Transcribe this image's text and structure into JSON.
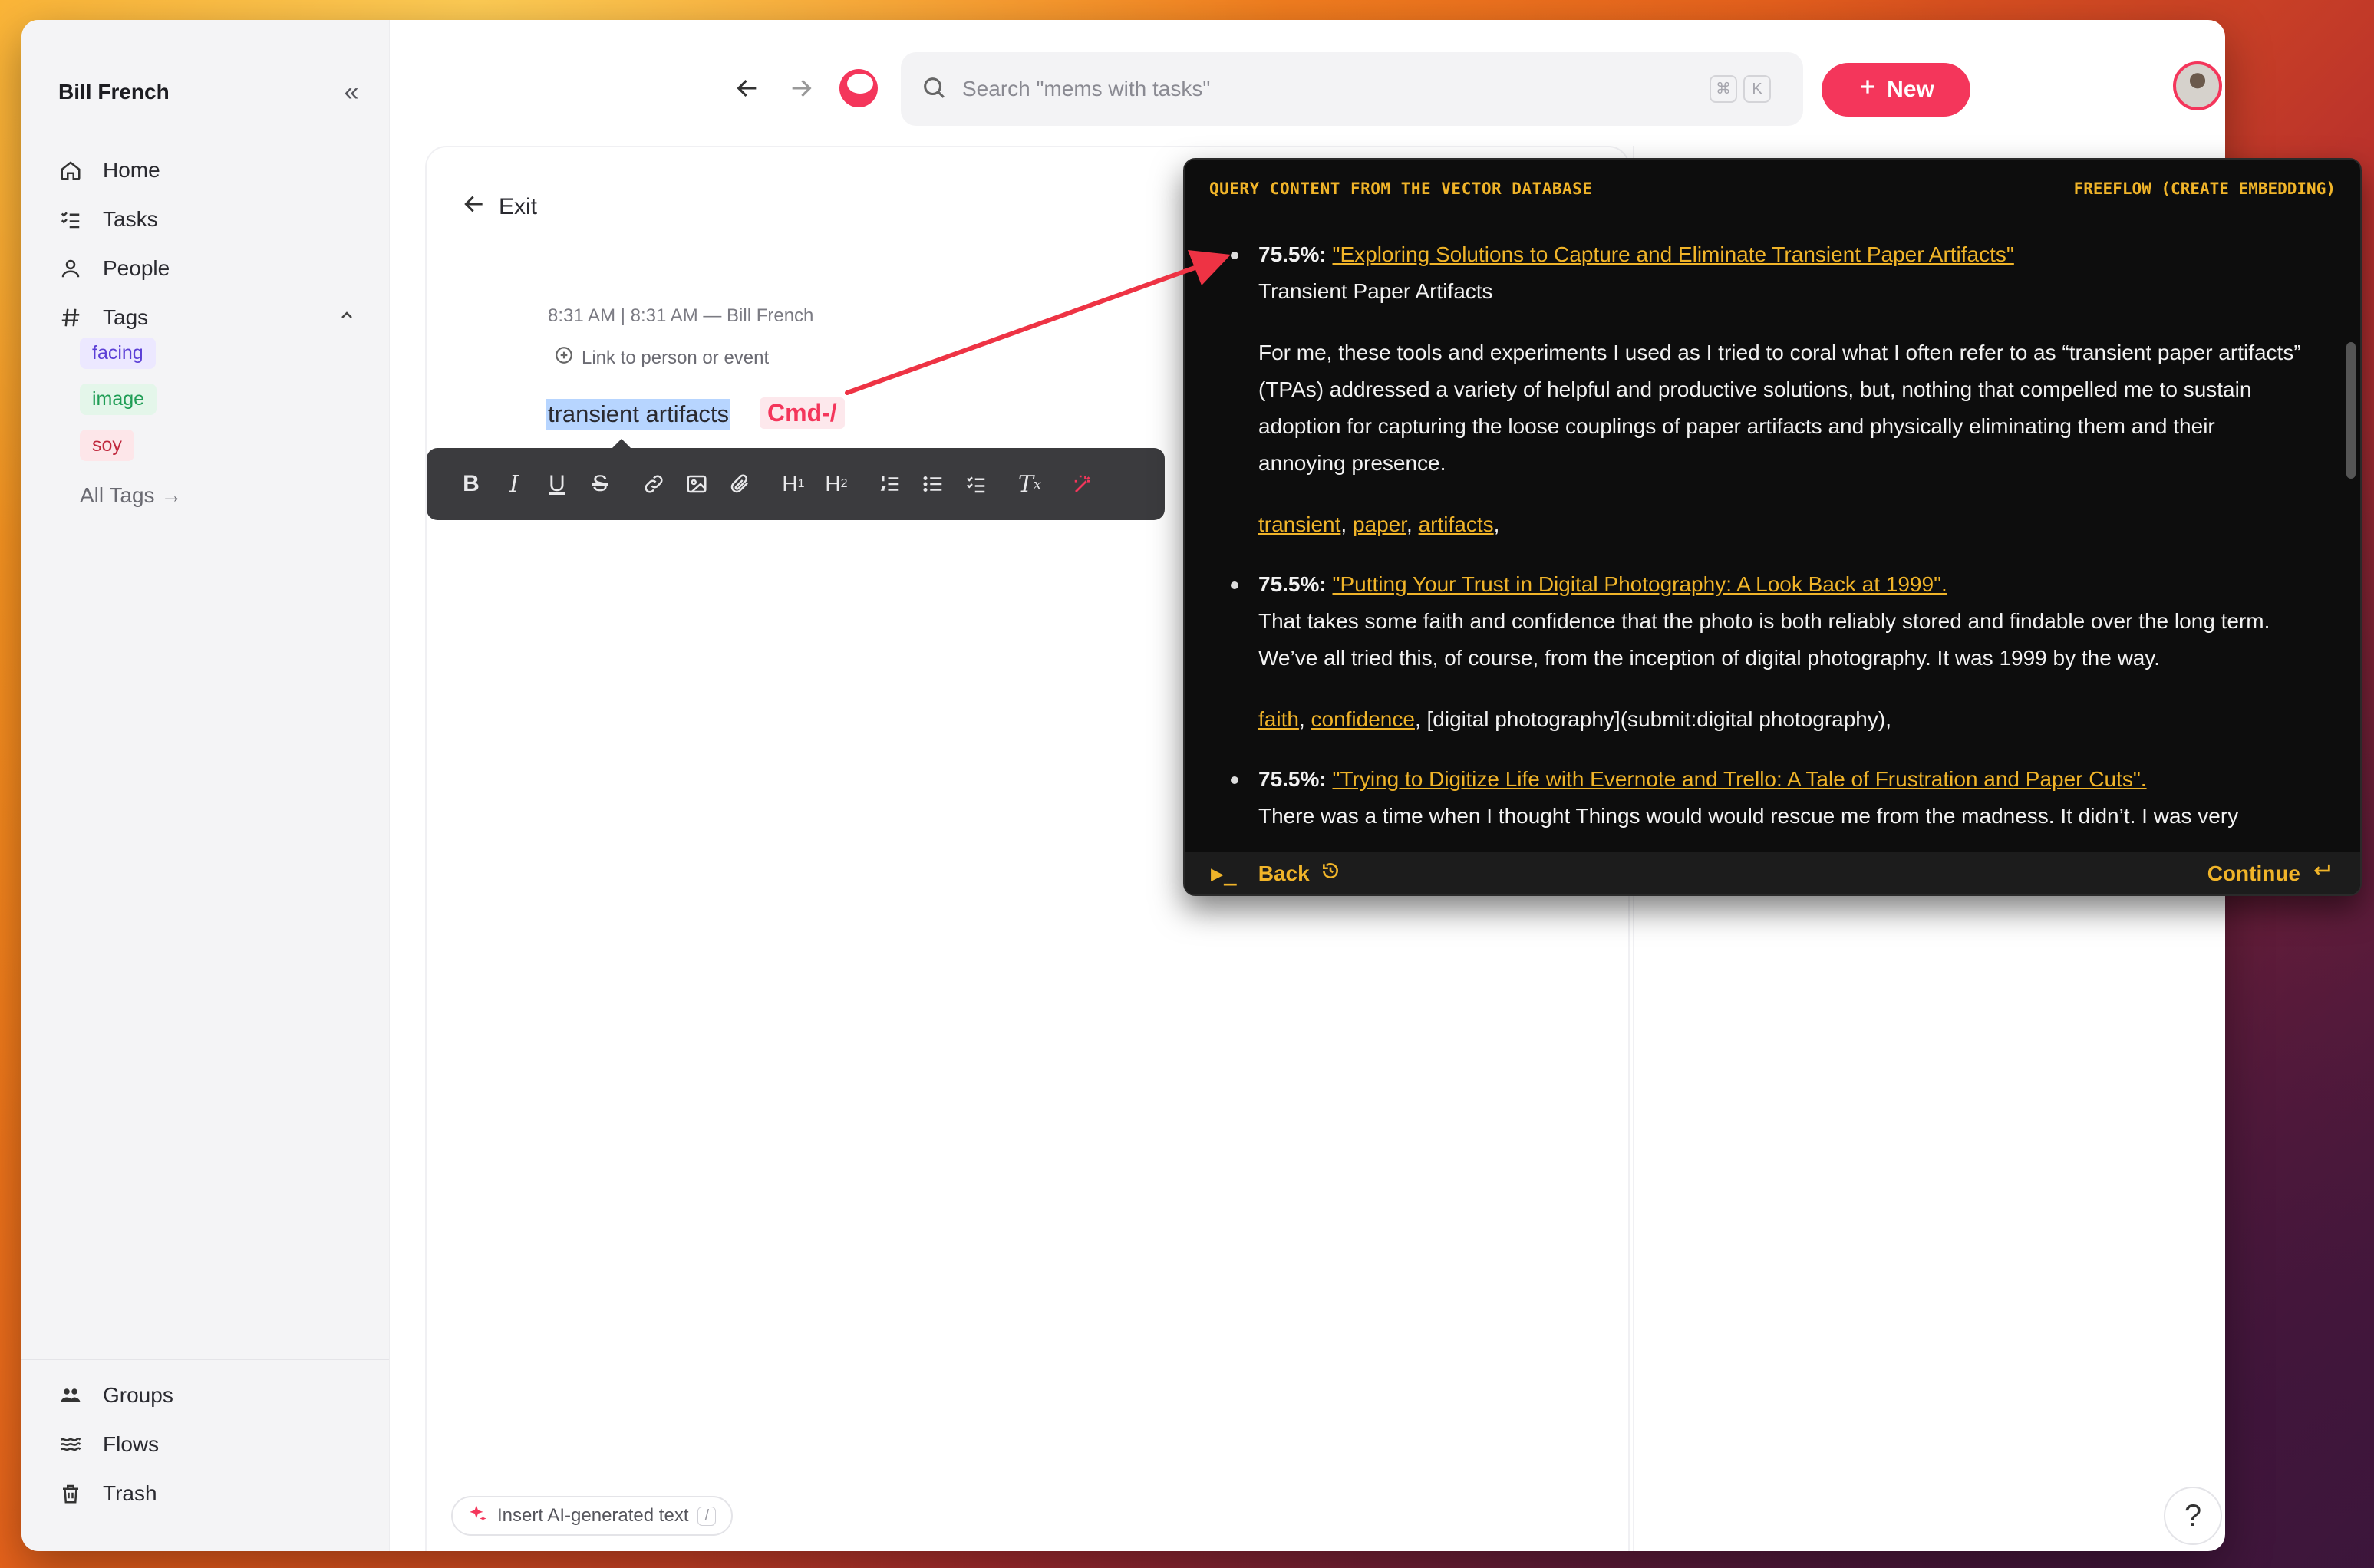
{
  "sidebar": {
    "user_name": "Bill French",
    "nav": [
      {
        "label": "Home",
        "icon": "home-icon"
      },
      {
        "label": "Tasks",
        "icon": "tasks-icon"
      },
      {
        "label": "People",
        "icon": "person-icon"
      },
      {
        "label": "Tags",
        "icon": "hash-icon"
      }
    ],
    "tags": [
      {
        "label": "facing",
        "color": "#5b3fd6",
        "bg": "#ece8ff"
      },
      {
        "label": "image",
        "color": "#1f9d55",
        "bg": "#e4f6ea"
      },
      {
        "label": "soy",
        "color": "#c0283d",
        "bg": "#fde6e9"
      }
    ],
    "all_tags": "All Tags →",
    "bottom": [
      {
        "label": "Groups",
        "icon": "groups-icon"
      },
      {
        "label": "Flows",
        "icon": "flows-icon"
      },
      {
        "label": "Trash",
        "icon": "trash-icon"
      }
    ]
  },
  "topbar": {
    "search_placeholder": "Search \"mems with tasks\"",
    "kbd1": "⌘",
    "kbd2": "K",
    "new_label": "New"
  },
  "editor": {
    "exit_label": "Exit",
    "meta": "8:31 AM | 8:31 AM — Bill French",
    "link_label": "Link to person or event",
    "selected_text": "transient artifacts",
    "cmd_hint": "Cmd-/",
    "insert_ai_label": "Insert AI-generated text",
    "insert_ai_shortcut": "/"
  },
  "overlay": {
    "header_left": "QUERY CONTENT FROM THE VECTOR DATABASE",
    "header_right": "FREEFLOW (CREATE EMBEDDING)",
    "results": [
      {
        "score": "75.5%:",
        "title": "\"Exploring Solutions to Capture and Eliminate Transient Paper Artifacts\"",
        "subtitle": "Transient Paper Artifacts",
        "body": "For me, these tools and experiments I used as I tried to coral what I often refer to as “transient paper artifacts” (TPAs) addressed a variety of helpful and productive solutions, but, nothing that compelled me to sustain adoption for capturing the loose couplings of paper artifacts and physically eliminating them and their annoying presence.",
        "tags": [
          "transient",
          "paper",
          "artifacts"
        ],
        "tags_extra": ""
      },
      {
        "score": "75.5%:",
        "title": "\"Putting Your Trust in Digital Photography: A Look Back at 1999\".",
        "subtitle": "",
        "body": "That takes some faith and confidence that the photo is both reliably stored and findable over the long term. We’ve all tried this, of course, from the inception of digital photography. It was 1999 by the way.",
        "tags": [
          "faith",
          "confidence"
        ],
        "tags_extra": "[digital photography](submit:digital photography),"
      },
      {
        "score": "75.5%:",
        "title": "\"Trying to Digitize Life with Evernote and Trello: A Tale of Frustration and Paper Cuts\".",
        "subtitle": "",
        "body": "There was a time when I thought Things would would rescue me from the madness. It didn’t. I was very",
        "tags": [],
        "tags_extra": ""
      }
    ],
    "back_label": "Back",
    "continue_label": "Continue"
  },
  "help_label": "?"
}
